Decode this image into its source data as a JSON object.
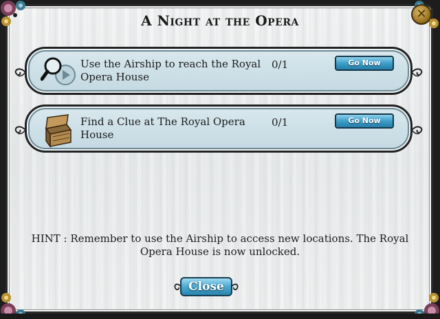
{
  "dialog": {
    "title": "A Night at the Opera",
    "close_icon_label": "✕"
  },
  "quests": [
    {
      "icon": "magnifier-icon",
      "text": "Use the Airship to reach the Royal Opera House",
      "progress": "0/1",
      "button_label": "Go Now"
    },
    {
      "icon": "treasure-chest-icon",
      "text": "Find a Clue at The Royal Opera House",
      "progress": "0/1",
      "button_label": "Go Now"
    }
  ],
  "hint": "HINT : Remember to use the Airship to access new locations. The Royal Opera House is now unlocked.",
  "footer": {
    "close_label": "Close"
  },
  "colors": {
    "button_blue": "#3d9fc9",
    "quest_bg": "#cfe1e8",
    "panel_bg": "#eceeef",
    "gold": "#a57d2a"
  }
}
